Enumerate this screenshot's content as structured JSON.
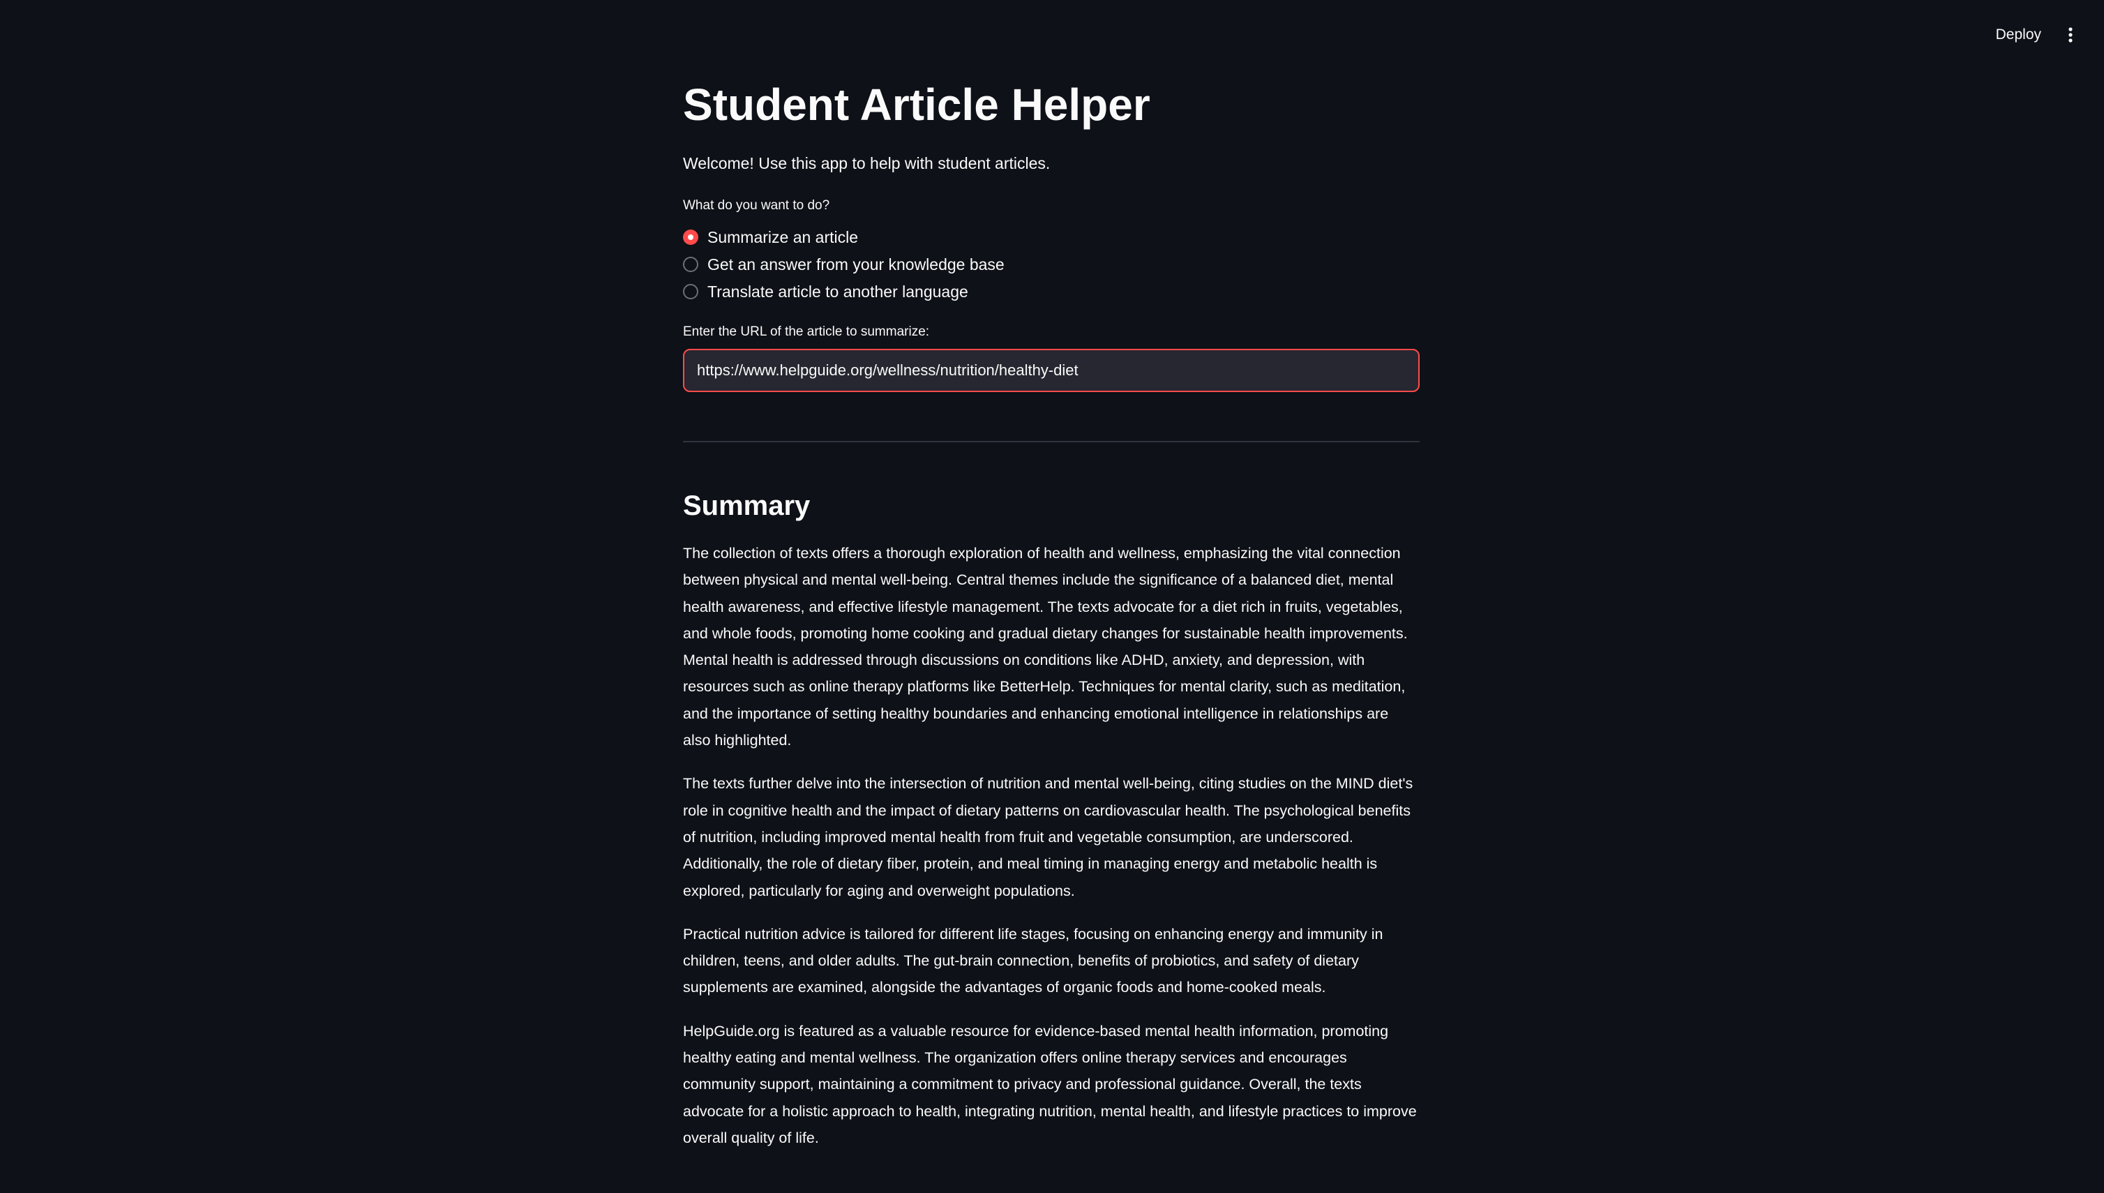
{
  "header": {
    "deploy_label": "Deploy",
    "menu_icon": "kebab-menu-icon"
  },
  "main": {
    "title": "Student Article Helper",
    "welcome": "Welcome! Use this app to help with student articles.",
    "task_prompt": "What do you want to do?",
    "options": [
      {
        "label": "Summarize an article",
        "selected": true
      },
      {
        "label": "Get an answer from your knowledge base",
        "selected": false
      },
      {
        "label": "Translate article to another language",
        "selected": false
      }
    ],
    "url_label": "Enter the URL of the article to summarize:",
    "url_value": "https://www.helpguide.org/wellness/nutrition/healthy-diet"
  },
  "summary": {
    "heading": "Summary",
    "paragraphs": [
      "The collection of texts offers a thorough exploration of health and wellness, emphasizing the vital connection between physical and mental well-being. Central themes include the significance of a balanced diet, mental health awareness, and effective lifestyle management. The texts advocate for a diet rich in fruits, vegetables, and whole foods, promoting home cooking and gradual dietary changes for sustainable health improvements. Mental health is addressed through discussions on conditions like ADHD, anxiety, and depression, with resources such as online therapy platforms like BetterHelp. Techniques for mental clarity, such as meditation, and the importance of setting healthy boundaries and enhancing emotional intelligence in relationships are also highlighted.",
      "The texts further delve into the intersection of nutrition and mental well-being, citing studies on the MIND diet's role in cognitive health and the impact of dietary patterns on cardiovascular health. The psychological benefits of nutrition, including improved mental health from fruit and vegetable consumption, are underscored. Additionally, the role of dietary fiber, protein, and meal timing in managing energy and metabolic health is explored, particularly for aging and overweight populations.",
      "Practical nutrition advice is tailored for different life stages, focusing on enhancing energy and immunity in children, teens, and older adults. The gut-brain connection, benefits of probiotics, and safety of dietary supplements are examined, alongside the advantages of organic foods and home-cooked meals.",
      "HelpGuide.org is featured as a valuable resource for evidence-based mental health information, promoting healthy eating and mental wellness. The organization offers online therapy services and encourages community support, maintaining a commitment to privacy and professional guidance. Overall, the texts advocate for a holistic approach to health, integrating nutrition, mental health, and lifestyle practices to improve overall quality of life."
    ]
  },
  "colors": {
    "background": "#0e1117",
    "text": "#fafafa",
    "accent": "#ff4b4b",
    "input_bg": "#262730"
  }
}
